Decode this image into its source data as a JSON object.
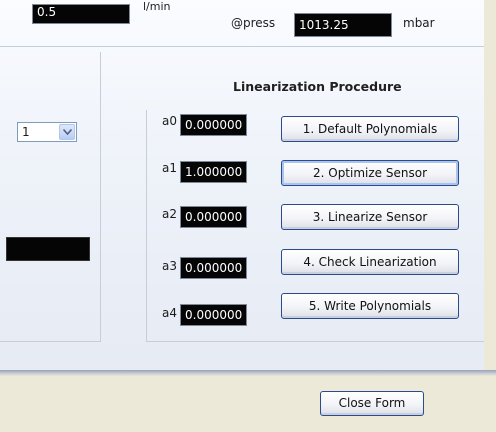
{
  "top": {
    "left_value": "0.5",
    "left_unit": "l/min",
    "press_label": "@press",
    "press_value": "1013.25",
    "press_unit": "mbar"
  },
  "selector": {
    "value": "1"
  },
  "linearization": {
    "title": "Linearization Procedure",
    "coefficients": [
      {
        "label": "a0",
        "value": "0.000000"
      },
      {
        "label": "a1",
        "value": "1.000000"
      },
      {
        "label": "a2",
        "value": "0.000000"
      },
      {
        "label": "a3",
        "value": "0.000000"
      },
      {
        "label": "a4",
        "value": "0.000000"
      }
    ],
    "buttons": [
      "1. Default Polynomials",
      "2.  Optimize  Sensor",
      "3.  Linearize  Sensor",
      "4. Check Linearization",
      "5. Write Polynomials"
    ]
  },
  "footer": {
    "close_label": "Close Form"
  }
}
